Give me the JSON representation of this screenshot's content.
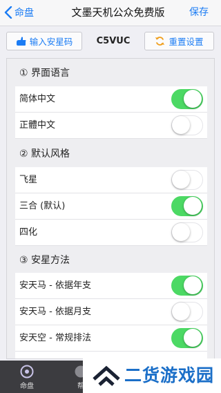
{
  "nav": {
    "back_label": "命盘",
    "title": "文墨天机公众免费版",
    "save_label": "保存"
  },
  "toolbar": {
    "input_label": "输入安星码",
    "code": "C5VUC",
    "reset_label": "重置设置"
  },
  "sections": [
    {
      "title": "① 界面语言",
      "rows": [
        {
          "label": "简体中文",
          "on": true
        },
        {
          "label": "正體中文",
          "on": false
        }
      ]
    },
    {
      "title": "② 默认风格",
      "rows": [
        {
          "label": "飞星",
          "on": false
        },
        {
          "label": "三合 (默认)",
          "on": true
        },
        {
          "label": "四化",
          "on": false
        }
      ]
    },
    {
      "title": "③ 安星方法",
      "rows": [
        {
          "label": "安天马 - 依据年支",
          "on": true
        },
        {
          "label": "安天马 - 依据月支",
          "on": false
        },
        {
          "label": "安天空 - 常规排法",
          "on": true
        }
      ]
    }
  ],
  "tabbar": {
    "items": [
      {
        "label": "命盘",
        "icon": "disc-icon"
      },
      {
        "label": "帮",
        "icon": "help-icon"
      }
    ]
  },
  "watermark": {
    "text": "二货游戏园"
  },
  "colors": {
    "accent": "#1b7cf4",
    "toggle_on": "#4cd964",
    "tabbar": "#3c3c40",
    "watermark": "#1b6fc8"
  }
}
